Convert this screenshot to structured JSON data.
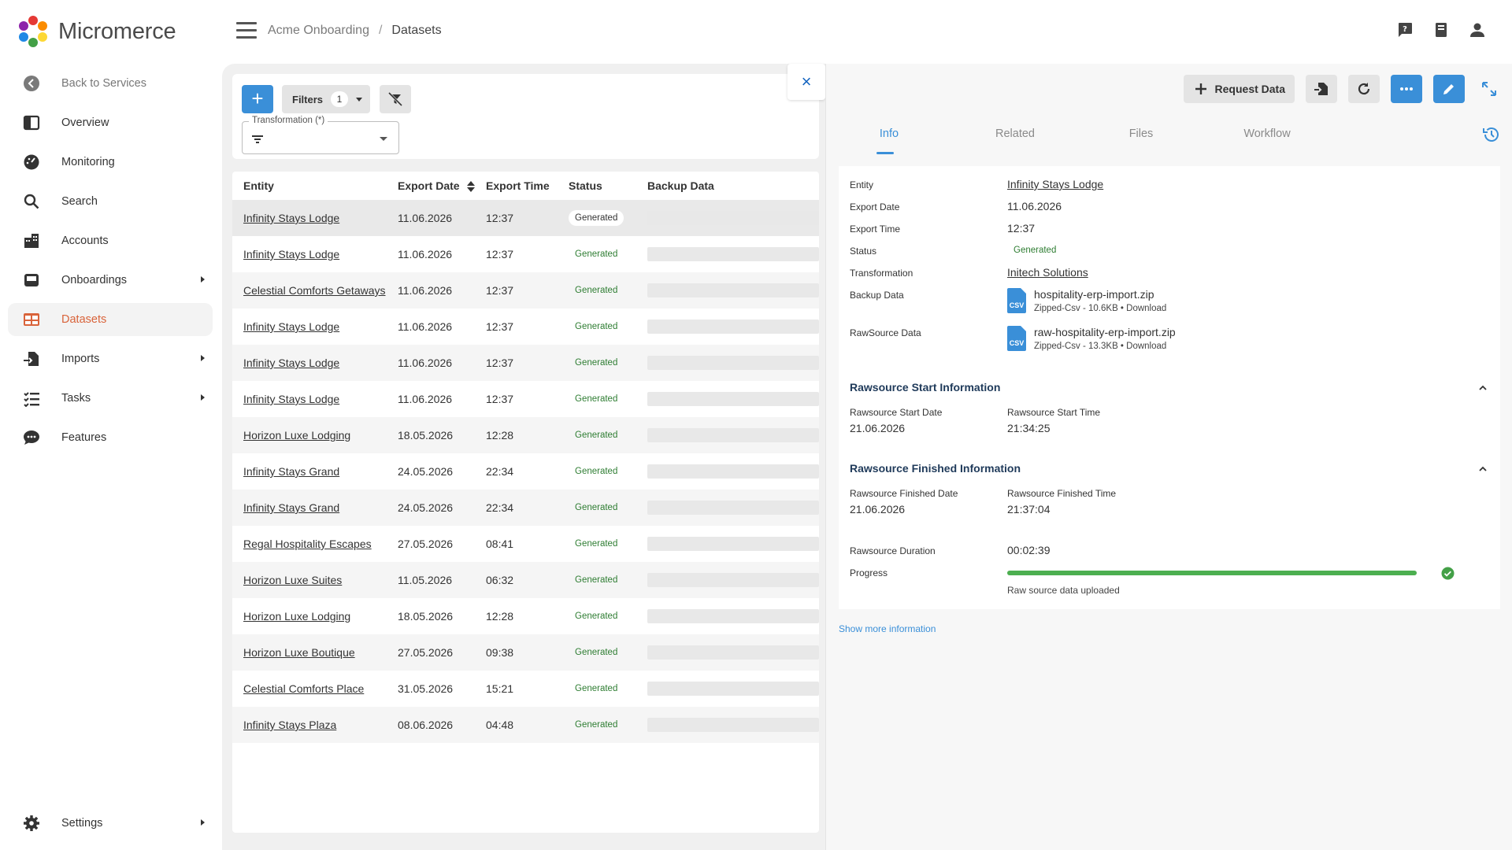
{
  "app": {
    "name": "Micromerce",
    "logo_colors": [
      "#e53935",
      "#fb8c00",
      "#fdd835",
      "#43a047",
      "#1e88e5",
      "#8e24aa"
    ]
  },
  "breadcrumb": {
    "parent": "Acme Onboarding",
    "separator": "/",
    "current": "Datasets"
  },
  "header_icons": [
    "help-chat-icon",
    "book-icon",
    "user-icon"
  ],
  "sidebar": {
    "items": [
      {
        "label": "Back to Services",
        "icon": "back-circle-icon",
        "back": true
      },
      {
        "label": "Overview",
        "icon": "overview-icon"
      },
      {
        "label": "Monitoring",
        "icon": "monitoring-icon"
      },
      {
        "label": "Search",
        "icon": "search-icon"
      },
      {
        "label": "Accounts",
        "icon": "accounts-icon"
      },
      {
        "label": "Onboardings",
        "icon": "onboardings-icon",
        "expandable": true
      },
      {
        "label": "Datasets",
        "icon": "datasets-icon",
        "active": true
      },
      {
        "label": "Imports",
        "icon": "imports-icon",
        "expandable": true
      },
      {
        "label": "Tasks",
        "icon": "tasks-icon",
        "expandable": true
      },
      {
        "label": "Features",
        "icon": "features-icon"
      }
    ],
    "settings_label": "Settings"
  },
  "toolbar": {
    "add_label": "+",
    "filters_label": "Filters",
    "filters_count": "1",
    "transformation_label": "Transformation (*)"
  },
  "table": {
    "columns": {
      "entity": "Entity",
      "export_date": "Export Date",
      "export_time": "Export Time",
      "status": "Status",
      "backup_data": "Backup Data"
    },
    "rows": [
      {
        "entity": "Infinity Stays Lodge",
        "date": "11.06.2026",
        "time": "12:37",
        "status": "Generated"
      },
      {
        "entity": "Infinity Stays Lodge",
        "date": "11.06.2026",
        "time": "12:37",
        "status": "Generated"
      },
      {
        "entity": "Celestial Comforts Getaways",
        "date": "11.06.2026",
        "time": "12:37",
        "status": "Generated"
      },
      {
        "entity": "Infinity Stays Lodge",
        "date": "11.06.2026",
        "time": "12:37",
        "status": "Generated"
      },
      {
        "entity": "Infinity Stays Lodge",
        "date": "11.06.2026",
        "time": "12:37",
        "status": "Generated"
      },
      {
        "entity": "Infinity Stays Lodge",
        "date": "11.06.2026",
        "time": "12:37",
        "status": "Generated"
      },
      {
        "entity": "Horizon Luxe Lodging",
        "date": "18.05.2026",
        "time": "12:28",
        "status": "Generated"
      },
      {
        "entity": "Infinity Stays Grand",
        "date": "24.05.2026",
        "time": "22:34",
        "status": "Generated"
      },
      {
        "entity": "Infinity Stays Grand",
        "date": "24.05.2026",
        "time": "22:34",
        "status": "Generated"
      },
      {
        "entity": "Regal Hospitality Escapes",
        "date": "27.05.2026",
        "time": "08:41",
        "status": "Generated"
      },
      {
        "entity": "Horizon Luxe Suites",
        "date": "11.05.2026",
        "time": "06:32",
        "status": "Generated"
      },
      {
        "entity": "Horizon Luxe Lodging",
        "date": "18.05.2026",
        "time": "12:28",
        "status": "Generated"
      },
      {
        "entity": "Horizon Luxe Boutique",
        "date": "27.05.2026",
        "time": "09:38",
        "status": "Generated"
      },
      {
        "entity": "Celestial Comforts Place",
        "date": "31.05.2026",
        "time": "15:21",
        "status": "Generated"
      },
      {
        "entity": "Infinity Stays Plaza",
        "date": "08.06.2026",
        "time": "04:48",
        "status": "Generated"
      }
    ]
  },
  "detail": {
    "close_label": "×",
    "request_data_label": "Request Data",
    "tabs": [
      "Info",
      "Related",
      "Files",
      "Workflow"
    ],
    "labels": {
      "entity": "Entity",
      "export_date": "Export Date",
      "export_time": "Export Time",
      "status": "Status",
      "transformation": "Transformation",
      "backup_data": "Backup Data",
      "rawsource_data": "RawSource Data"
    },
    "values": {
      "entity": "Infinity Stays Lodge",
      "export_date": "11.06.2026",
      "export_time": "12:37",
      "status": "Generated",
      "transformation": "Initech Solutions"
    },
    "backup_file": {
      "icon_text": "CSV",
      "name": "hospitality-erp-import.zip",
      "meta": "Zipped-Csv - 10.6KB • Download"
    },
    "raw_file": {
      "icon_text": "CSV",
      "name": "raw-hospitality-erp-import.zip",
      "meta": "Zipped-Csv - 13.3KB • Download"
    },
    "start_section": {
      "title": "Rawsource Start Information",
      "date_label": "Rawsource Start Date",
      "date": "21.06.2026",
      "time_label": "Rawsource Start Time",
      "time": "21:34:25"
    },
    "finished_section": {
      "title": "Rawsource Finished Information",
      "date_label": "Rawsource Finished Date",
      "date": "21.06.2026",
      "time_label": "Rawsource Finished Time",
      "time": "21:37:04"
    },
    "duration_label": "Rawsource Duration",
    "duration": "00:02:39",
    "progress_label": "Progress",
    "progress_percent": 100,
    "progress_note": "Raw source data uploaded",
    "show_more": "Show more information"
  },
  "colors": {
    "accent": "#3a8fd8",
    "active_nav": "#d9633a",
    "status_green": "#2e7d32",
    "progress_green": "#4caf50"
  }
}
